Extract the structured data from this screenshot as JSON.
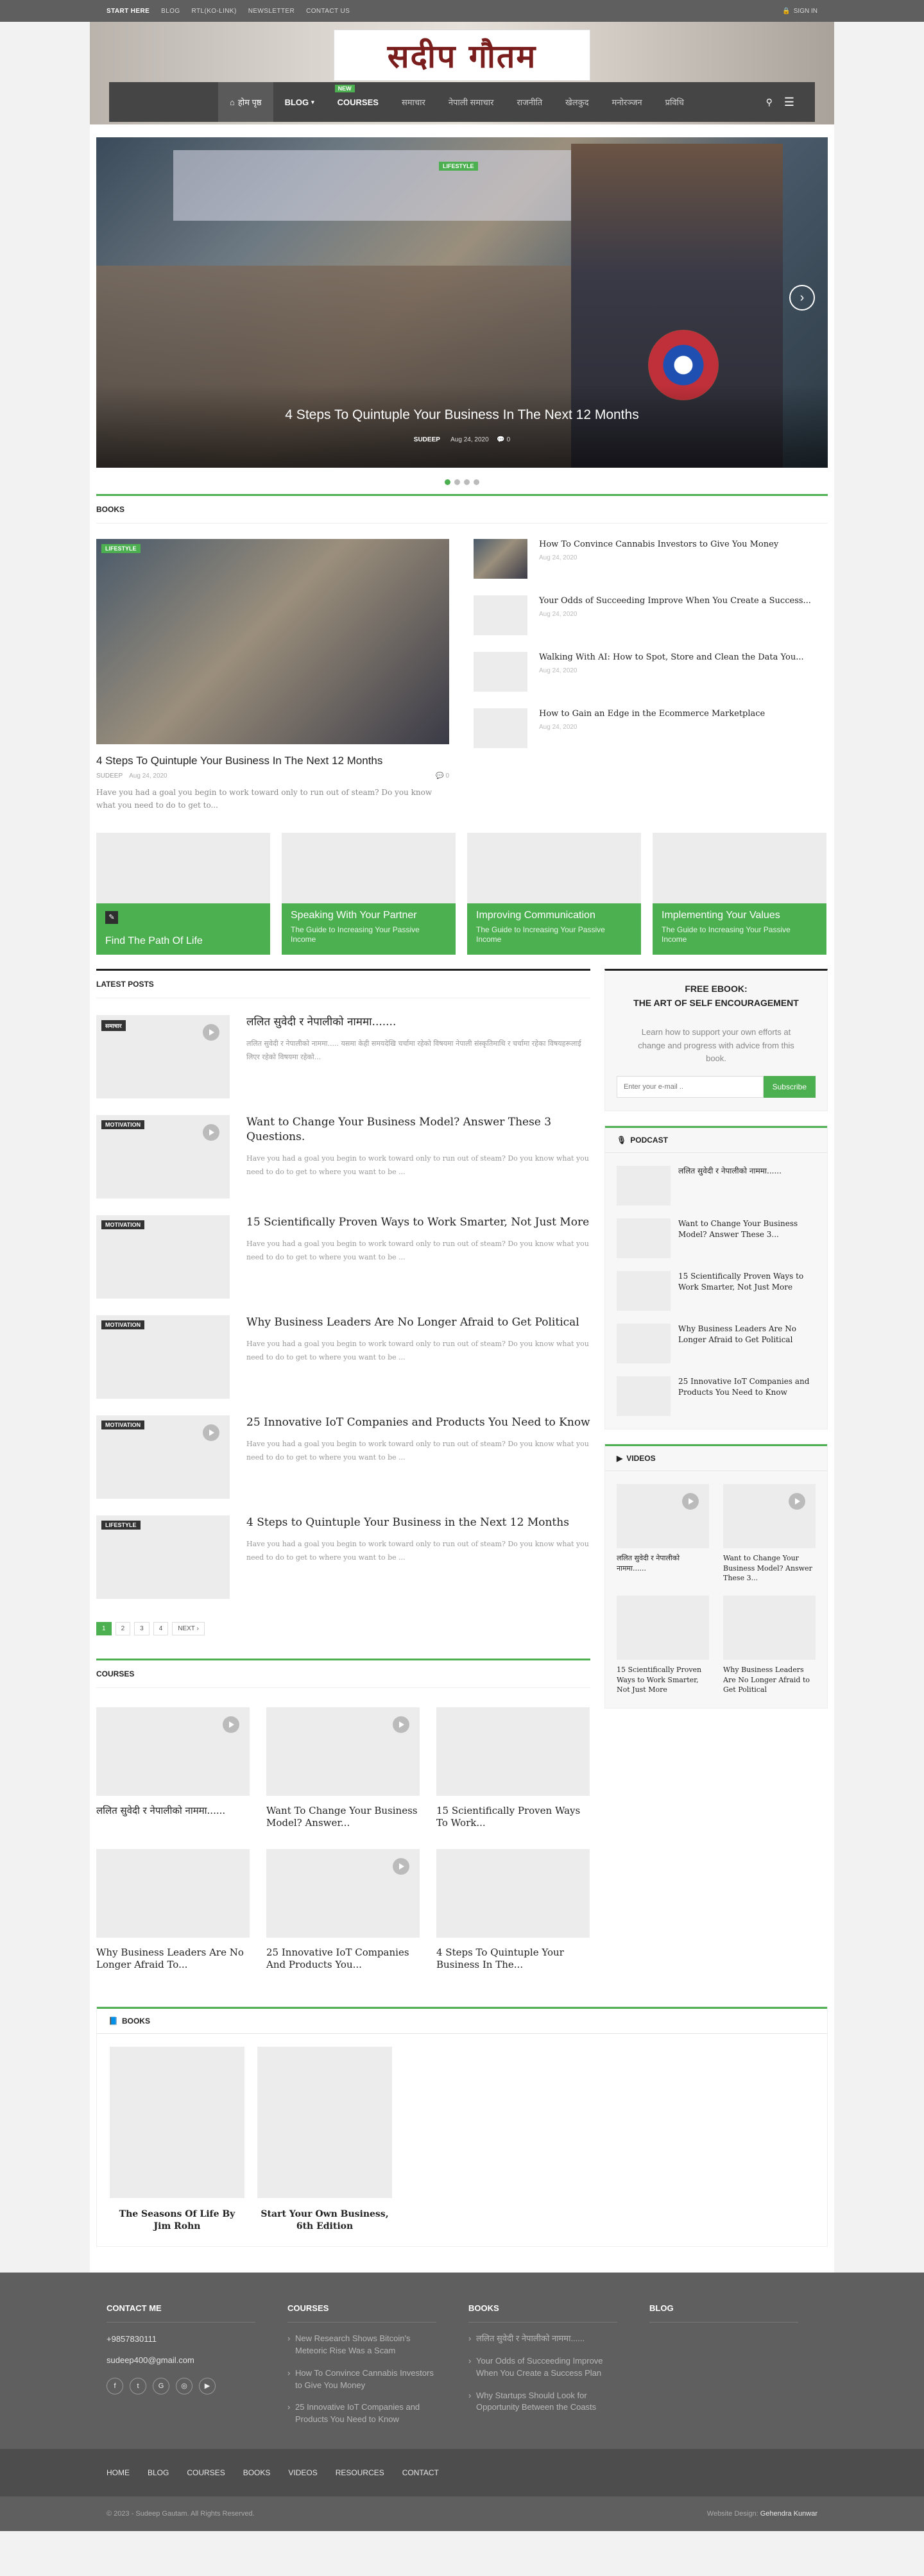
{
  "topbar": {
    "links": [
      "START HERE",
      "BLOG",
      "RTL(KO-LINK)",
      "NEWSLETTER",
      "CONTACT US"
    ],
    "signin": "SIGN IN"
  },
  "header": {
    "logo_text": "सदीप गौतम",
    "nav": [
      "होम पृष्ठ",
      "BLOG",
      "COURSES",
      "समाचार",
      "नेपाली समाचार",
      "राजनीति",
      "खेलकुद",
      "मनोरञ्जन",
      "प्रविधि"
    ],
    "new_badge": "NEW"
  },
  "slider": {
    "category": "LIFESTYLE",
    "title": "4 Steps To Quintuple Your Business In The Next 12 Months",
    "author": "SUDEEP",
    "date": "Aug 24, 2020",
    "comments": "0"
  },
  "books_section": {
    "title": "BOOKS",
    "main": {
      "category": "LIFESTYLE",
      "title": "4 Steps To Quintuple Your Business In The Next 12 Months",
      "author": "SUDEEP",
      "date": "Aug 24, 2020",
      "comments": "0",
      "excerpt": "Have you had a goal you begin to work toward only to run out of steam? Do you know what you need to do to get to..."
    },
    "side": [
      {
        "title": "How To Convince Cannabis Investors to Give You Money",
        "date": "Aug 24, 2020"
      },
      {
        "title": "Your Odds of Succeeding Improve When You Create a Success...",
        "date": "Aug 24, 2020"
      },
      {
        "title": "Walking With AI: How to Spot, Store and Clean the Data You...",
        "date": "Aug 24, 2020"
      },
      {
        "title": "How to Gain an Edge in the Ecommerce Marketplace",
        "date": "Aug 24, 2020"
      }
    ]
  },
  "cards": [
    {
      "title": "Find The Path Of Life",
      "sub": ""
    },
    {
      "title": "Speaking With Your Partner",
      "sub": "The Guide to Increasing Your Passive Income"
    },
    {
      "title": "Improving Communication",
      "sub": "The Guide to Increasing Your Passive Income"
    },
    {
      "title": "Implementing Your Values",
      "sub": "The Guide to Increasing Your Passive Income"
    }
  ],
  "latest": {
    "title": "LATEST POSTS",
    "posts": [
      {
        "cat": "समाचार",
        "title": "ललित सुवेदी र नेपालीको नाममा.......",
        "excerpt": "ललित सुवेदी र नेपालीको नाममा..... यसमा केही समयदेखि चर्चामा रहेको विषयमा नेपाली संस्कृतिमाथि र चर्चामा रहेका विषयहरूलाई लिएर रहेको विषयमा रहेको...",
        "video": true
      },
      {
        "cat": "MOTIVATION",
        "title": "Want to Change Your Business Model? Answer These 3 Questions.",
        "excerpt": "Have you had a goal you begin to work toward only to run out of steam? Do you know what you need to do to get to where you want to be ...",
        "video": true
      },
      {
        "cat": "MOTIVATION",
        "title": "15 Scientifically Proven Ways to Work Smarter, Not Just More",
        "excerpt": "Have you had a goal you begin to work toward only to run out of steam? Do you know what you need to do to get to where you want to be ...",
        "video": false
      },
      {
        "cat": "MOTIVATION",
        "title": "Why Business Leaders Are No Longer Afraid to Get Political",
        "excerpt": "Have you had a goal you begin to work toward only to run out of steam? Do you know what you need to do to get to where you want to be ...",
        "video": false
      },
      {
        "cat": "MOTIVATION",
        "title": "25 Innovative IoT Companies and Products You Need to Know",
        "excerpt": "Have you had a goal you begin to work toward only to run out of steam? Do you know what you need to do to get to where you want to be ...",
        "video": true
      },
      {
        "cat": "LIFESTYLE",
        "title": "4 Steps to Quintuple Your Business in the Next 12 Months",
        "excerpt": "Have you had a goal you begin to work toward only to run out of steam? Do you know what you need to do to get to where you want to be ...",
        "video": false
      }
    ],
    "pages": [
      "1",
      "2",
      "3",
      "4",
      "NEXT ›"
    ]
  },
  "courses": {
    "title": "COURSES",
    "items": [
      {
        "title": "ललित सुवेदी र नेपालीको नाममा......",
        "video": true
      },
      {
        "title": "Want To Change Your Business Model? Answer...",
        "video": true
      },
      {
        "title": "15 Scientifically Proven Ways To Work...",
        "video": false
      },
      {
        "title": "Why Business Leaders Are No Longer Afraid To...",
        "video": false
      },
      {
        "title": "25 Innovative IoT Companies And Products You...",
        "video": true
      },
      {
        "title": "4 Steps To Quintuple Your Business In The...",
        "video": false
      }
    ]
  },
  "sidebar": {
    "ebook": {
      "title1": "FREE EBOOK:",
      "title2": "THE ART OF SELF ENCOURAGEMENT",
      "desc": "Learn how to support your own efforts at change and progress with advice from this book.",
      "placeholder": "Enter your e-mail ..",
      "button": "Subscribe"
    },
    "podcast": {
      "title": "PODCAST",
      "items": [
        "ललित सुवेदी र नेपालीको नाममा......",
        "Want to Change Your Business Model? Answer These 3...",
        "15 Scientifically Proven Ways to Work Smarter, Not Just More",
        "Why Business Leaders Are No Longer Afraid to Get Political",
        "25 Innovative IoT Companies and Products You Need to Know"
      ]
    },
    "videos": {
      "title": "VIDEOS",
      "items": [
        {
          "title": "ललित सुवेदी र नेपालीको नाममा......",
          "video": true
        },
        {
          "title": "Want to Change Your Business Model? Answer These 3...",
          "video": true
        },
        {
          "title": "15 Scientifically Proven Ways to Work Smarter, Not Just More",
          "video": false
        },
        {
          "title": "Why Business Leaders Are No Longer Afraid to Get Political",
          "video": false
        }
      ]
    }
  },
  "books2": {
    "title": "BOOKS",
    "items": [
      "The Seasons Of Life By Jim Rohn",
      "Start Your Own Business, 6th Edition"
    ]
  },
  "footer": {
    "contact_title": "CONTACT ME",
    "phone": "+9857830111",
    "email": "sudeep400@gmail.com",
    "courses_title": "COURSES",
    "courses": [
      "New Research Shows Bitcoin's Meteoric Rise Was a Scam",
      "How To Convince Cannabis Investors to Give You Money",
      "25 Innovative IoT Companies and Products You Need to Know"
    ],
    "books_title": "BOOKS",
    "books": [
      "ललित सुवेदी र नेपालीको नाममा......",
      "Your Odds of Succeeding Improve When You Create a Success Plan",
      "Why Startups Should Look for Opportunity Between the Coasts"
    ],
    "blog_title": "BLOG",
    "nav": [
      "HOME",
      "BLOG",
      "COURSES",
      "BOOKS",
      "VIDEOS",
      "RESOURCES",
      "CONTACT"
    ],
    "copyright": "© 2023 - Sudeep Gautam. All Rights Reserved.",
    "design_label": "Website Design:",
    "designer": "Gehendra Kunwar"
  },
  "colors": {
    "accent": "#4caf50",
    "topbar": "#5f5f5f",
    "nav": "#454545"
  }
}
